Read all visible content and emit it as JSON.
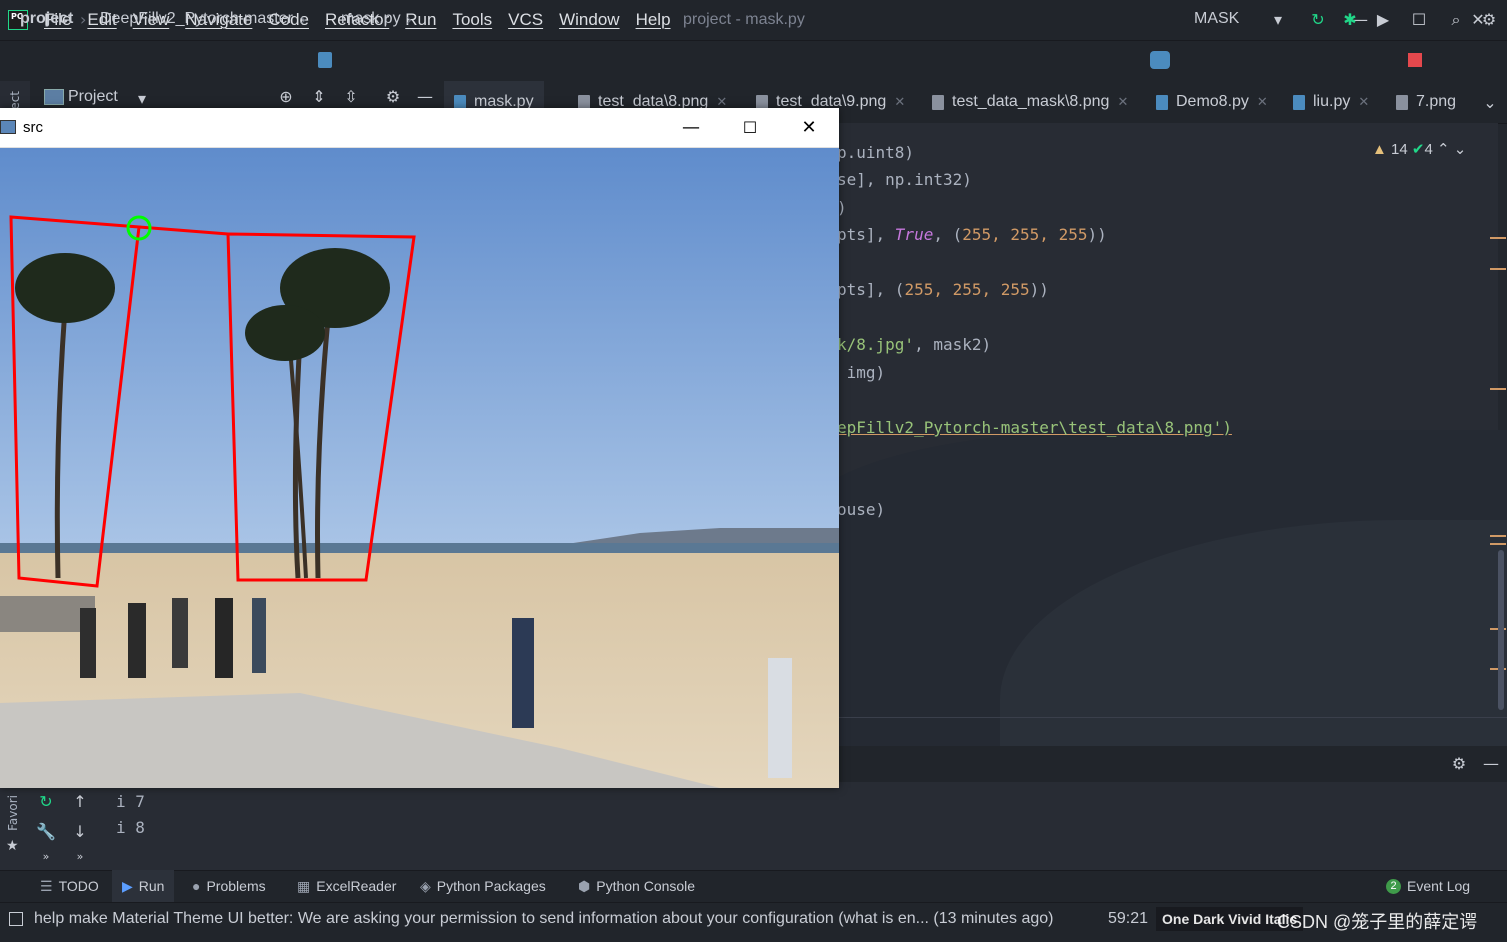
{
  "menu": {
    "items": [
      "File",
      "Edit",
      "View",
      "Navigate",
      "Code",
      "Refactor",
      "Run",
      "Tools",
      "VCS",
      "Window",
      "Help"
    ],
    "title": "project - mask.py"
  },
  "breadcrumb": {
    "project": "project",
    "folder": "DeepFillv2_Pytorch-master",
    "file": "mask.py"
  },
  "run_config": "MASK",
  "project_tool": {
    "side_label": "ect",
    "label": "Project"
  },
  "tabs": [
    {
      "label": "mask.py",
      "type": "py"
    },
    {
      "label": "test_data\\8.png",
      "type": "img"
    },
    {
      "label": "test_data\\9.png",
      "type": "img"
    },
    {
      "label": "test_data_mask\\8.png",
      "type": "img"
    },
    {
      "label": "Demo8.py",
      "type": "py"
    },
    {
      "label": "liu.py",
      "type": "py"
    },
    {
      "label": "7.png",
      "type": "img"
    }
  ],
  "inspections": {
    "warnings": "14",
    "ok": "4"
  },
  "code": {
    "line1": "p.uint8)",
    "line2": "se], np.int32)",
    "line3": ")",
    "line4_pre": "pts], ",
    "line4_kw": "True",
    "line4_mid": ", (",
    "line4_nums": "255, 255, 255",
    "line4_post": "))",
    "line5_pre": "pts], (",
    "line5_nums": "255, 255, 255",
    "line5_post": "))",
    "line6_str": "k/8.jpg'",
    "line6_post": ", mask2)",
    "line7": " img)",
    "line8_str": "epFillv2_Pytorch-master\\test_data\\8.png')",
    "line9": "ouse)"
  },
  "run_output": {
    "line1": "i 7",
    "line2": "i 8"
  },
  "favorites_label": "Favori",
  "tool_windows": [
    "TODO",
    "Run",
    "Problems",
    "ExcelReader",
    "Python Packages",
    "Python Console"
  ],
  "event_log": {
    "count": "2",
    "label": "Event Log"
  },
  "status": {
    "message": "help make Material Theme UI better: We are asking your permission to send information about your configuration (what is en... (13 minutes ago)",
    "caret": "59:21",
    "theme": "One Dark Vivid Italic",
    "watermark": "CSDN @笼子里的薛定谔"
  },
  "src_window": {
    "title": "src"
  },
  "colors": {
    "accent_green": "#21d789",
    "error_red": "#e5484d",
    "mask_red": "#ff0000",
    "point_green": "#00ff00"
  }
}
